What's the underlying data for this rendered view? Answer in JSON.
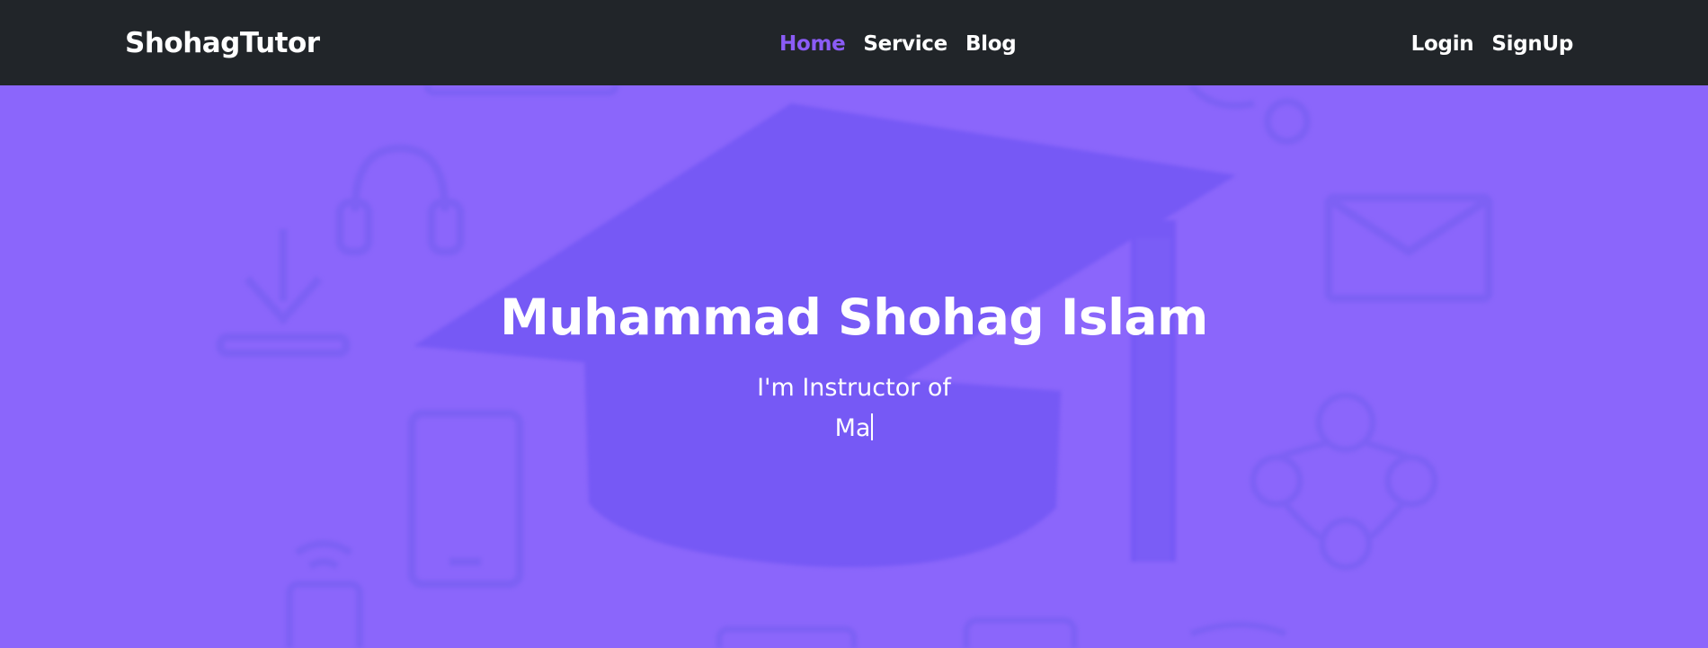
{
  "navbar": {
    "brand": "ShohagTutor",
    "links": [
      {
        "label": "Home",
        "active": true
      },
      {
        "label": "Service",
        "active": false
      },
      {
        "label": "Blog",
        "active": false
      }
    ],
    "auth": [
      {
        "label": "Login"
      },
      {
        "label": "SignUp"
      }
    ]
  },
  "hero": {
    "name": "Muhammad Shohag Islam",
    "subtitle": "I'm Instructor of",
    "typed_text": "Ma"
  },
  "colors": {
    "navbar_bg": "#212529",
    "hero_bg": "#8b66fb",
    "accent": "#8b5cf6",
    "text": "#ffffff"
  },
  "background_icons": [
    "graduation-cap-icon",
    "headphones-icon",
    "download-icon",
    "tablet-icon",
    "envelope-icon",
    "network-icon",
    "wifi-icon"
  ]
}
